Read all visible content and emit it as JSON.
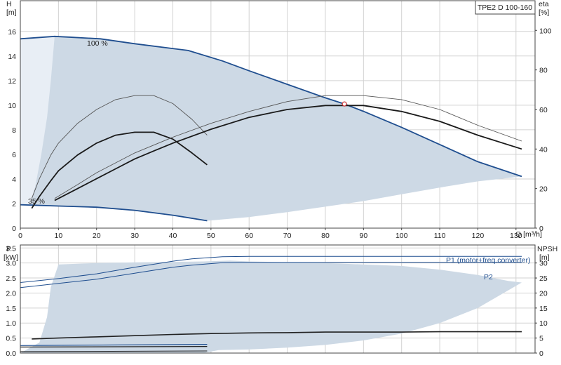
{
  "chart_data": [
    {
      "type": "line",
      "title": "TPE2 D 100-160",
      "xlabel": "Q [m³/h]",
      "ylabel_left": "H",
      "ylabel_left_unit": "[m]",
      "ylabel_right": "eta",
      "ylabel_right_unit": "[%]",
      "xlim": [
        0,
        135
      ],
      "ylim_left": [
        0,
        18.5
      ],
      "ylim_right": [
        0,
        115
      ],
      "x_ticks": [
        0,
        10,
        20,
        30,
        40,
        50,
        60,
        70,
        80,
        90,
        100,
        110,
        120,
        130
      ],
      "y_ticks_left": [
        0,
        2,
        4,
        6,
        8,
        10,
        12,
        14,
        16
      ],
      "y_ticks_right": [
        0,
        20,
        40,
        60,
        80,
        100
      ],
      "grid": true,
      "curve_labels": [
        "100 %",
        "35 %"
      ],
      "operating_point": {
        "x": 85,
        "y": 10.1
      },
      "range_area": {
        "upper": [
          [
            0,
            15.4
          ],
          [
            5,
            15.5
          ],
          [
            9,
            15.6
          ],
          [
            13,
            15.6
          ],
          [
            21,
            15.4
          ],
          [
            30,
            15.0
          ],
          [
            40,
            14.6
          ],
          [
            44,
            14.45
          ],
          [
            53,
            13.6
          ],
          [
            60,
            12.8
          ],
          [
            70,
            11.7
          ],
          [
            80,
            10.6
          ],
          [
            85,
            10.1
          ],
          [
            90,
            9.5
          ],
          [
            100,
            8.2
          ],
          [
            110,
            6.8
          ],
          [
            120,
            5.4
          ],
          [
            131.5,
            4.2
          ]
        ],
        "lower": [
          [
            0,
            1.9
          ],
          [
            10,
            1.8
          ],
          [
            20,
            1.7
          ],
          [
            30,
            1.45
          ],
          [
            40,
            1.05
          ],
          [
            49,
            0.6
          ],
          [
            60,
            0.9
          ],
          [
            70,
            1.3
          ],
          [
            80,
            1.75
          ],
          [
            90,
            2.2
          ],
          [
            100,
            2.75
          ],
          [
            110,
            3.3
          ],
          [
            120,
            3.8
          ],
          [
            131.5,
            4.2
          ]
        ]
      },
      "range_left_area": [
        [
          0,
          1.9
        ],
        [
          0,
          15.4
        ],
        [
          5,
          15.5
        ],
        [
          9,
          15.6
        ],
        [
          8,
          12
        ],
        [
          7,
          9
        ],
        [
          5.5,
          6
        ],
        [
          4,
          3.5
        ],
        [
          2.5,
          1.9
        ]
      ],
      "series": [
        {
          "role": "head",
          "weight": "heavy",
          "values": [
            [
              0,
              15.4
            ],
            [
              9,
              15.6
            ],
            [
              21,
              15.4
            ],
            [
              30,
              15.0
            ],
            [
              44,
              14.45
            ],
            [
              53,
              13.6
            ],
            [
              60,
              12.8
            ],
            [
              70,
              11.7
            ],
            [
              80,
              10.6
            ],
            [
              85,
              10.1
            ],
            [
              90,
              9.5
            ],
            [
              100,
              8.2
            ],
            [
              110,
              6.8
            ],
            [
              120,
              5.4
            ],
            [
              131.5,
              4.2
            ]
          ]
        },
        {
          "role": "head",
          "weight": "heavy",
          "values": [
            [
              0,
              1.9
            ],
            [
              10,
              1.8
            ],
            [
              20,
              1.7
            ],
            [
              30,
              1.45
            ],
            [
              40,
              1.05
            ],
            [
              49,
              0.6
            ]
          ]
        },
        {
          "role": "eta",
          "weight": "thin",
          "values": [
            [
              3,
              15
            ],
            [
              5,
              25
            ],
            [
              8,
              37
            ],
            [
              10,
              43
            ],
            [
              15,
              53
            ],
            [
              20,
              60
            ],
            [
              25,
              65
            ],
            [
              30,
              67
            ],
            [
              35,
              67
            ],
            [
              40,
              63
            ],
            [
              45,
              55
            ],
            [
              49,
              47
            ]
          ]
        },
        {
          "role": "eta",
          "weight": "heavy",
          "values": [
            [
              3,
              10
            ],
            [
              5,
              16
            ],
            [
              8,
              24
            ],
            [
              10,
              29
            ],
            [
              15,
              37
            ],
            [
              20,
              43
            ],
            [
              25,
              47
            ],
            [
              30,
              48.5
            ],
            [
              35,
              48.5
            ],
            [
              40,
              45
            ],
            [
              45,
              38
            ],
            [
              49,
              32
            ]
          ]
        },
        {
          "role": "eta",
          "weight": "thin",
          "values": [
            [
              9,
              15
            ],
            [
              15,
              22
            ],
            [
              20,
              28
            ],
            [
              25,
              33
            ],
            [
              30,
              38
            ],
            [
              35,
              42
            ],
            [
              40,
              46
            ],
            [
              50,
              53
            ],
            [
              60,
              59
            ],
            [
              70,
              64
            ],
            [
              80,
              67
            ],
            [
              90,
              67
            ],
            [
              100,
              65
            ],
            [
              110,
              60
            ],
            [
              120,
              52
            ],
            [
              131.5,
              44
            ]
          ]
        },
        {
          "role": "eta",
          "weight": "heavy",
          "values": [
            [
              9,
              14
            ],
            [
              15,
              20
            ],
            [
              20,
              25
            ],
            [
              25,
              30
            ],
            [
              30,
              35
            ],
            [
              35,
              39
            ],
            [
              40,
              43
            ],
            [
              50,
              50
            ],
            [
              60,
              56
            ],
            [
              70,
              60
            ],
            [
              80,
              62
            ],
            [
              90,
              62
            ],
            [
              100,
              59
            ],
            [
              110,
              54
            ],
            [
              120,
              47
            ],
            [
              131.5,
              40
            ]
          ]
        }
      ]
    },
    {
      "type": "line",
      "ylabel_left": "P",
      "ylabel_left_unit": "[kW]",
      "ylabel_right": "NPSH",
      "ylabel_right_unit": "[m]",
      "xlim": [
        0,
        135
      ],
      "ylim_left": [
        0,
        3.6
      ],
      "ylim_right": [
        0,
        36
      ],
      "y_ticks_left": [
        0.0,
        0.5,
        1.0,
        1.5,
        2.0,
        2.5,
        3.0,
        3.5
      ],
      "y_ticks_left_labels": [
        "0.0",
        "0.5",
        "1.0",
        "1.5",
        "2.0",
        "2.5",
        "3.0",
        "3.5"
      ],
      "y_ticks_right": [
        0,
        5,
        10,
        15,
        20,
        25,
        30
      ],
      "grid": true,
      "curve_labels": [
        "P1 (motor+freq.converter)",
        "P2"
      ],
      "npsh_area": [
        [
          0,
          0
        ],
        [
          5,
          0.35
        ],
        [
          7,
          1.2
        ],
        [
          8,
          2.2
        ],
        [
          10,
          2.95
        ],
        [
          20,
          3.0
        ],
        [
          30,
          3.02
        ],
        [
          48,
          3.05
        ],
        [
          55,
          3.08
        ],
        [
          60,
          3.05
        ],
        [
          80,
          3.0
        ],
        [
          100,
          2.9
        ],
        [
          110,
          2.78
        ],
        [
          120,
          2.6
        ],
        [
          128,
          2.4
        ],
        [
          131.5,
          2.35
        ],
        [
          120,
          1.5
        ],
        [
          110,
          1.0
        ],
        [
          100,
          0.65
        ],
        [
          90,
          0.42
        ],
        [
          80,
          0.27
        ],
        [
          70,
          0.18
        ],
        [
          60,
          0.12
        ],
        [
          52,
          0.1
        ],
        [
          48,
          0.0
        ]
      ],
      "series": [
        {
          "role": "P1",
          "color": "#1f4e8f",
          "values": [
            [
              0,
              2.35
            ],
            [
              10,
              2.48
            ],
            [
              20,
              2.64
            ],
            [
              30,
              2.86
            ],
            [
              40,
              3.06
            ],
            [
              45,
              3.14
            ],
            [
              53,
              3.21
            ],
            [
              60,
              3.22
            ],
            [
              80,
              3.22
            ],
            [
              100,
              3.22
            ],
            [
              120,
              3.22
            ],
            [
              131.5,
              3.22
            ]
          ]
        },
        {
          "role": "P2",
          "color": "#1f4e8f",
          "values": [
            [
              0,
              2.18
            ],
            [
              10,
              2.32
            ],
            [
              20,
              2.46
            ],
            [
              30,
              2.66
            ],
            [
              40,
              2.86
            ],
            [
              45,
              2.93
            ],
            [
              53,
              3.01
            ],
            [
              60,
              3.02
            ],
            [
              80,
              3.02
            ],
            [
              100,
              3.02
            ],
            [
              120,
              3.02
            ],
            [
              131.5,
              3.02
            ]
          ]
        },
        {
          "role": "P-low",
          "color": "#1f4e8f",
          "values": [
            [
              0,
              0.25
            ],
            [
              49,
              0.29
            ]
          ]
        },
        {
          "role": "P-low",
          "color": "#222222",
          "values": [
            [
              0,
              0.2
            ],
            [
              49,
              0.22
            ]
          ]
        },
        {
          "role": "NPSH",
          "color": "#222222",
          "values": [
            [
              3,
              0.47
            ],
            [
              10,
              0.5
            ],
            [
              20,
              0.54
            ],
            [
              30,
              0.58
            ],
            [
              40,
              0.62
            ],
            [
              50,
              0.65
            ],
            [
              60,
              0.67
            ],
            [
              70,
              0.68
            ],
            [
              80,
              0.7
            ],
            [
              90,
              0.7
            ],
            [
              100,
              0.7
            ],
            [
              110,
              0.71
            ],
            [
              120,
              0.71
            ],
            [
              131.5,
              0.71
            ]
          ]
        },
        {
          "role": "NPSH",
          "color": "#222222",
          "values": [
            [
              0,
              0.05
            ],
            [
              49,
              0.07
            ]
          ]
        }
      ]
    }
  ]
}
